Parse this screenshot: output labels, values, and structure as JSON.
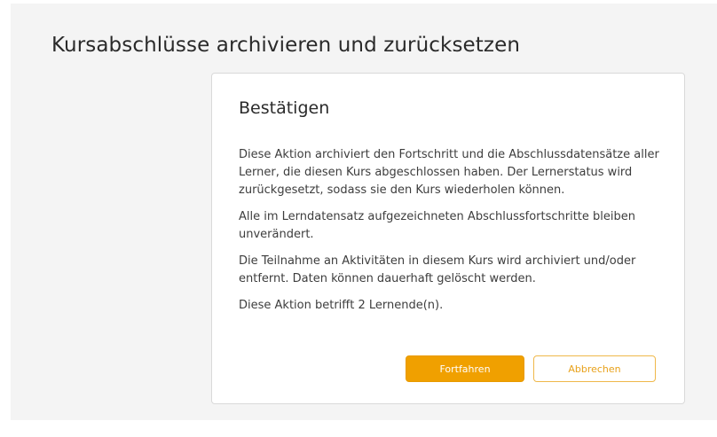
{
  "page": {
    "title": "Kursabschlüsse archivieren und zurücksetzen"
  },
  "dialog": {
    "title": "Bestätigen",
    "paragraphs": [
      "Diese Aktion archiviert den Fortschritt und die Abschlussdatensätze aller Lerner, die diesen Kurs abgeschlossen haben. Der Lernerstatus wird zurückgesetzt, sodass sie den Kurs wiederholen können.",
      "Alle im Lerndatensatz aufgezeichneten Abschlussfortschritte bleiben unverändert.",
      "Die Teilnahme an Aktivitäten in diesem Kurs wird archiviert und/oder entfernt. Daten können dauerhaft gelöscht werden.",
      "Diese Aktion betrifft 2 Lernende(n)."
    ],
    "confirm_label": "Fortfahren",
    "cancel_label": "Abbrechen"
  },
  "colors": {
    "accent": "#f0a000",
    "background": "#f4f4f4"
  }
}
